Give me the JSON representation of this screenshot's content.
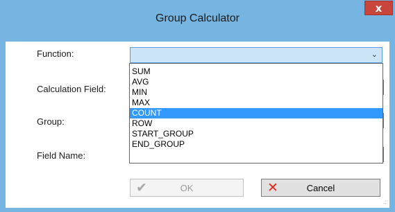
{
  "window": {
    "title": "Group Calculator",
    "close_glyph": "x",
    "colors": {
      "frame": "#76b5e1",
      "close_button": "#c7453a",
      "selection": "#3399ff",
      "combo_fill": "#cce4f7"
    }
  },
  "form": {
    "function_label": "Function:",
    "calc_field_label": "Calculation Field:",
    "group_label": "Group:",
    "field_name_label": "Field Name:",
    "function_value": "",
    "dropdown_arrow": "⌄"
  },
  "dropdown": {
    "options": [
      "SUM",
      "AVG",
      "MIN",
      "MAX",
      "COUNT",
      "ROW",
      "START_GROUP",
      "END_GROUP"
    ],
    "highlighted": "COUNT"
  },
  "buttons": {
    "ok": {
      "label": "OK",
      "icon": "check-icon",
      "enabled": false
    },
    "cancel": {
      "label": "Cancel",
      "icon": "x-icon",
      "enabled": true
    }
  }
}
